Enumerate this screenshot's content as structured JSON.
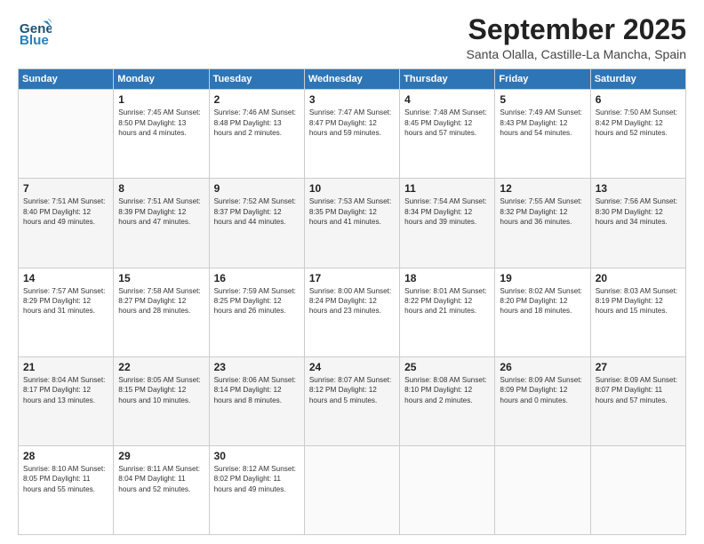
{
  "header": {
    "logo_general": "General",
    "logo_blue": "Blue",
    "month_title": "September 2025",
    "subtitle": "Santa Olalla, Castille-La Mancha, Spain"
  },
  "days_of_week": [
    "Sunday",
    "Monday",
    "Tuesday",
    "Wednesday",
    "Thursday",
    "Friday",
    "Saturday"
  ],
  "weeks": [
    [
      {
        "day": "",
        "info": ""
      },
      {
        "day": "1",
        "info": "Sunrise: 7:45 AM\nSunset: 8:50 PM\nDaylight: 13 hours\nand 4 minutes."
      },
      {
        "day": "2",
        "info": "Sunrise: 7:46 AM\nSunset: 8:48 PM\nDaylight: 13 hours\nand 2 minutes."
      },
      {
        "day": "3",
        "info": "Sunrise: 7:47 AM\nSunset: 8:47 PM\nDaylight: 12 hours\nand 59 minutes."
      },
      {
        "day": "4",
        "info": "Sunrise: 7:48 AM\nSunset: 8:45 PM\nDaylight: 12 hours\nand 57 minutes."
      },
      {
        "day": "5",
        "info": "Sunrise: 7:49 AM\nSunset: 8:43 PM\nDaylight: 12 hours\nand 54 minutes."
      },
      {
        "day": "6",
        "info": "Sunrise: 7:50 AM\nSunset: 8:42 PM\nDaylight: 12 hours\nand 52 minutes."
      }
    ],
    [
      {
        "day": "7",
        "info": "Sunrise: 7:51 AM\nSunset: 8:40 PM\nDaylight: 12 hours\nand 49 minutes."
      },
      {
        "day": "8",
        "info": "Sunrise: 7:51 AM\nSunset: 8:39 PM\nDaylight: 12 hours\nand 47 minutes."
      },
      {
        "day": "9",
        "info": "Sunrise: 7:52 AM\nSunset: 8:37 PM\nDaylight: 12 hours\nand 44 minutes."
      },
      {
        "day": "10",
        "info": "Sunrise: 7:53 AM\nSunset: 8:35 PM\nDaylight: 12 hours\nand 41 minutes."
      },
      {
        "day": "11",
        "info": "Sunrise: 7:54 AM\nSunset: 8:34 PM\nDaylight: 12 hours\nand 39 minutes."
      },
      {
        "day": "12",
        "info": "Sunrise: 7:55 AM\nSunset: 8:32 PM\nDaylight: 12 hours\nand 36 minutes."
      },
      {
        "day": "13",
        "info": "Sunrise: 7:56 AM\nSunset: 8:30 PM\nDaylight: 12 hours\nand 34 minutes."
      }
    ],
    [
      {
        "day": "14",
        "info": "Sunrise: 7:57 AM\nSunset: 8:29 PM\nDaylight: 12 hours\nand 31 minutes."
      },
      {
        "day": "15",
        "info": "Sunrise: 7:58 AM\nSunset: 8:27 PM\nDaylight: 12 hours\nand 28 minutes."
      },
      {
        "day": "16",
        "info": "Sunrise: 7:59 AM\nSunset: 8:25 PM\nDaylight: 12 hours\nand 26 minutes."
      },
      {
        "day": "17",
        "info": "Sunrise: 8:00 AM\nSunset: 8:24 PM\nDaylight: 12 hours\nand 23 minutes."
      },
      {
        "day": "18",
        "info": "Sunrise: 8:01 AM\nSunset: 8:22 PM\nDaylight: 12 hours\nand 21 minutes."
      },
      {
        "day": "19",
        "info": "Sunrise: 8:02 AM\nSunset: 8:20 PM\nDaylight: 12 hours\nand 18 minutes."
      },
      {
        "day": "20",
        "info": "Sunrise: 8:03 AM\nSunset: 8:19 PM\nDaylight: 12 hours\nand 15 minutes."
      }
    ],
    [
      {
        "day": "21",
        "info": "Sunrise: 8:04 AM\nSunset: 8:17 PM\nDaylight: 12 hours\nand 13 minutes."
      },
      {
        "day": "22",
        "info": "Sunrise: 8:05 AM\nSunset: 8:15 PM\nDaylight: 12 hours\nand 10 minutes."
      },
      {
        "day": "23",
        "info": "Sunrise: 8:06 AM\nSunset: 8:14 PM\nDaylight: 12 hours\nand 8 minutes."
      },
      {
        "day": "24",
        "info": "Sunrise: 8:07 AM\nSunset: 8:12 PM\nDaylight: 12 hours\nand 5 minutes."
      },
      {
        "day": "25",
        "info": "Sunrise: 8:08 AM\nSunset: 8:10 PM\nDaylight: 12 hours\nand 2 minutes."
      },
      {
        "day": "26",
        "info": "Sunrise: 8:09 AM\nSunset: 8:09 PM\nDaylight: 12 hours\nand 0 minutes."
      },
      {
        "day": "27",
        "info": "Sunrise: 8:09 AM\nSunset: 8:07 PM\nDaylight: 11 hours\nand 57 minutes."
      }
    ],
    [
      {
        "day": "28",
        "info": "Sunrise: 8:10 AM\nSunset: 8:05 PM\nDaylight: 11 hours\nand 55 minutes."
      },
      {
        "day": "29",
        "info": "Sunrise: 8:11 AM\nSunset: 8:04 PM\nDaylight: 11 hours\nand 52 minutes."
      },
      {
        "day": "30",
        "info": "Sunrise: 8:12 AM\nSunset: 8:02 PM\nDaylight: 11 hours\nand 49 minutes."
      },
      {
        "day": "",
        "info": ""
      },
      {
        "day": "",
        "info": ""
      },
      {
        "day": "",
        "info": ""
      },
      {
        "day": "",
        "info": ""
      }
    ]
  ]
}
